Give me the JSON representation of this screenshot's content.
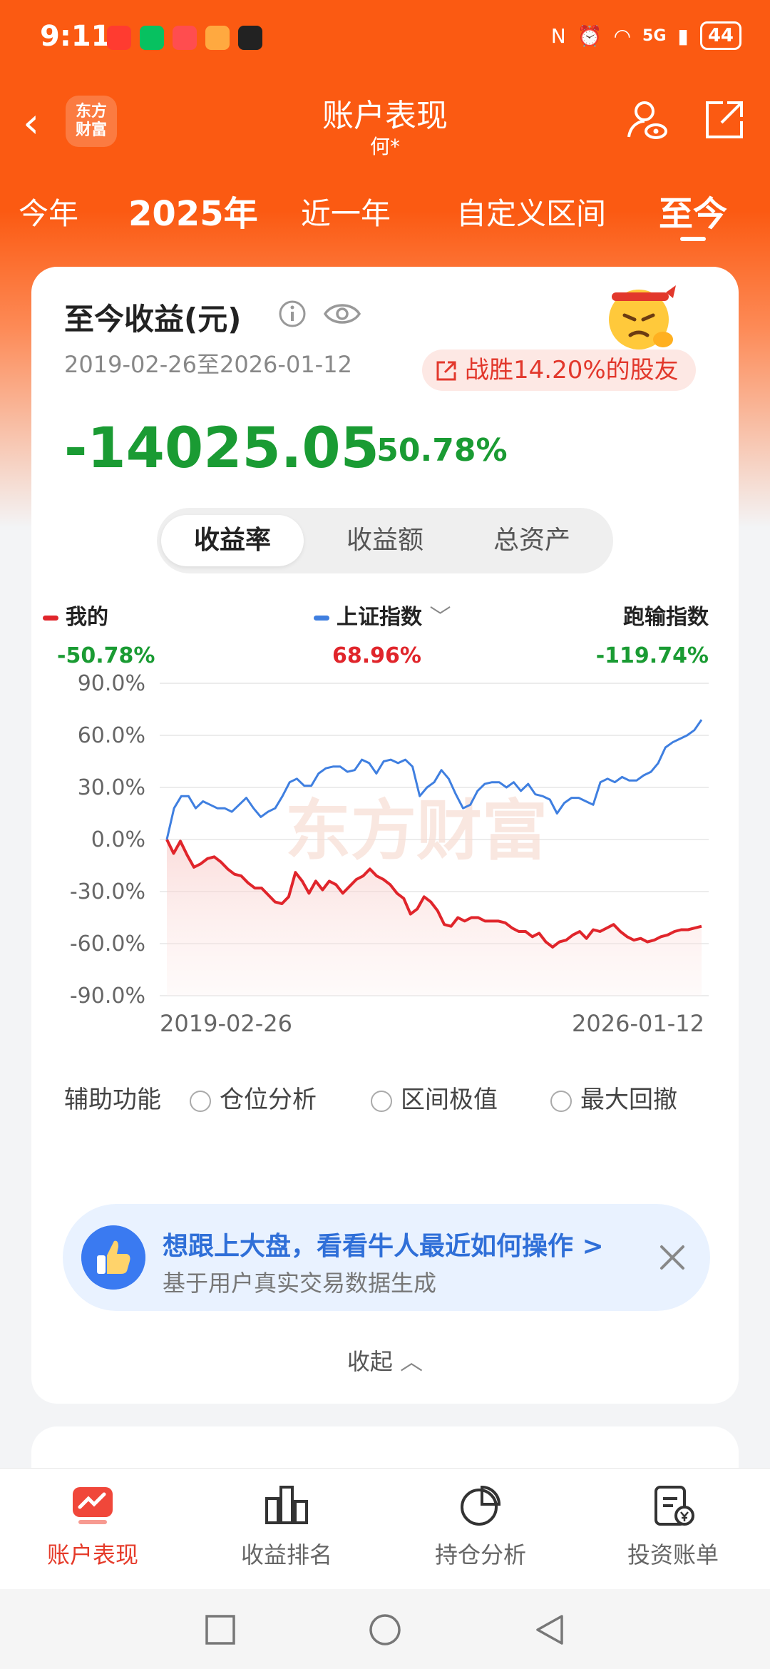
{
  "status_bar": {
    "time": "9:11",
    "network": "5G",
    "battery": "44"
  },
  "header": {
    "logo_text": "东方\n财富",
    "title": "账户表现",
    "subtitle": "何*"
  },
  "period_tabs": [
    "今年",
    "2025年",
    "近一年",
    "自定义区间",
    "至今"
  ],
  "active_period": "至今",
  "summary": {
    "title": "至今收益(元)",
    "date_range": "2019-02-26至2026-01-12",
    "beat_text": "战胜14.20%的股友",
    "amount": "-14025.05",
    "rate": "-50.78%"
  },
  "segments": [
    "收益率",
    "收益额",
    "总资产"
  ],
  "active_segment": "收益率",
  "legend": [
    {
      "name": "我的",
      "value": "-50.78%",
      "color": "#e0252b",
      "value_color": "#1a9b33"
    },
    {
      "name": "上证指数",
      "value": "68.96%",
      "color": "#3f7fe0",
      "value_color": "#e0252b"
    },
    {
      "name": "跑输指数",
      "value": "-119.74%",
      "value_color": "#1a9b33"
    }
  ],
  "chart_data": {
    "type": "line",
    "y_ticks": [
      "90.0%",
      "60.0%",
      "30.0%",
      "0.0%",
      "-30.0%",
      "-60.0%",
      "-90.0%"
    ],
    "ylim": [
      -90,
      90
    ],
    "x_labels": [
      "2019-02-26",
      "2026-01-12"
    ],
    "watermark": "东方财富",
    "series": [
      {
        "name": "我的",
        "color": "#e0252b",
        "values": [
          0,
          -8,
          -1,
          -9,
          -16,
          -14,
          -11,
          -10,
          -13,
          -17,
          -20,
          -21,
          -25,
          -28,
          -28,
          -32,
          -36,
          -37,
          -33,
          -19,
          -24,
          -31,
          -24,
          -29,
          -24,
          -26,
          -31,
          -27,
          -23,
          -21,
          -17,
          -21,
          -23,
          -26,
          -31,
          -34,
          -43,
          -40,
          -33,
          -36,
          -41,
          -49,
          -50,
          -45,
          -47,
          -45,
          -45,
          -47,
          -47,
          -47,
          -48,
          -51,
          -53,
          -53,
          -56,
          -54,
          -59,
          -62,
          -59,
          -58,
          -55,
          -53,
          -57,
          -52,
          -53,
          -51,
          -49,
          -53,
          -56,
          -58,
          -57,
          -59,
          -58,
          -56,
          -55,
          -53,
          -52,
          -52,
          -51,
          -50
        ]
      },
      {
        "name": "上证指数",
        "color": "#3f7fe0",
        "values": [
          0,
          18,
          25,
          25,
          18,
          22,
          20,
          18,
          18,
          16,
          20,
          24,
          18,
          13,
          16,
          18,
          25,
          33,
          35,
          31,
          31,
          38,
          41,
          42,
          42,
          39,
          40,
          46,
          44,
          38,
          45,
          46,
          44,
          46,
          42,
          25,
          30,
          33,
          40,
          35,
          26,
          18,
          20,
          28,
          32,
          33,
          33,
          30,
          33,
          28,
          32,
          26,
          25,
          23,
          15,
          21,
          24,
          24,
          22,
          20,
          33,
          35,
          33,
          36,
          34,
          34,
          37,
          39,
          44,
          53,
          56,
          58,
          60,
          63,
          69
        ]
      }
    ]
  },
  "aux": {
    "label": "辅助功能",
    "options": [
      "仓位分析",
      "区间极值",
      "最大回撤"
    ]
  },
  "promo": {
    "title": "想跟上大盘，看看牛人最近如何操作 >",
    "subtitle": "基于用户真实交易数据生成"
  },
  "collapse_label": "收起",
  "bottom_nav": [
    "账户表现",
    "收益排名",
    "持仓分析",
    "投资账单"
  ],
  "active_nav": "账户表现"
}
